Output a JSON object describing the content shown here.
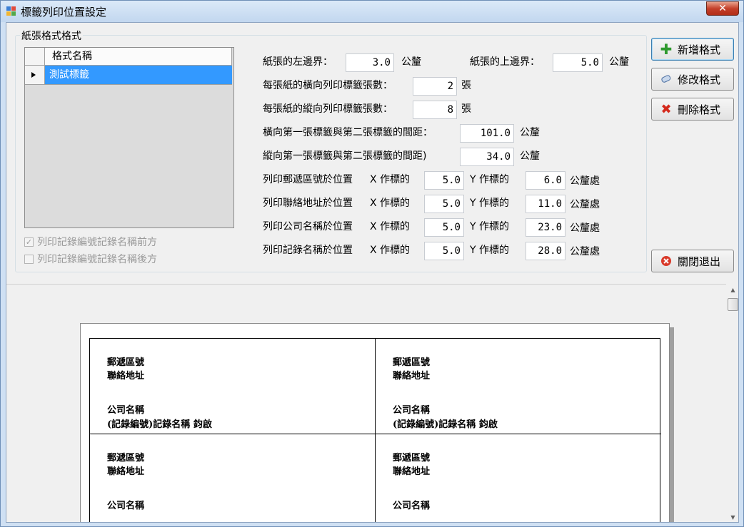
{
  "window": {
    "title": "標籤列印位置設定",
    "close_label": "✕"
  },
  "group": {
    "title": "紙張格式格式"
  },
  "grid": {
    "column_header": "格式名稱",
    "rows": [
      "測試標籤"
    ]
  },
  "checkboxes": [
    {
      "label": "列印記錄編號記錄名稱前方",
      "checked": true
    },
    {
      "label": "列印記錄編號記錄名稱後方",
      "checked": false
    }
  ],
  "settings": {
    "left_margin_label": "紙張的左邊界：",
    "left_margin": "3.0",
    "top_margin_label": "紙張的上邊界：",
    "top_margin": "5.0",
    "unit_mm": "公釐",
    "horizontal_count_label": "每張紙的橫向列印標籤張數：",
    "horizontal_count": "2",
    "vertical_count_label": "每張紙的縱向列印標籤張數：",
    "vertical_count": "8",
    "unit_sheet": "張",
    "h_gap_label": "橫向第一張標籤與第二張標籤的間距：",
    "h_gap": "101.0",
    "v_gap_label": "縱向第一張標籤與第二張標籤的間距)",
    "v_gap": "34.0"
  },
  "positions": {
    "x_label": "X 作標的",
    "y_label": "Y 作標的",
    "unit_label": "公釐處",
    "rows": [
      {
        "label": "列印郵遞區號於位置",
        "x": "5.0",
        "y": "6.0"
      },
      {
        "label": "列印聯絡地址於位置",
        "x": "5.0",
        "y": "11.0"
      },
      {
        "label": "列印公司名稱於位置",
        "x": "5.0",
        "y": "23.0"
      },
      {
        "label": "列印記錄名稱於位置",
        "x": "5.0",
        "y": "28.0"
      }
    ]
  },
  "buttons": {
    "add": "新增格式",
    "edit": "修改格式",
    "delete": "刪除格式",
    "exit": "關閉退出"
  },
  "preview": {
    "labels": [
      {
        "postal": "郵遞區號",
        "address": "聯絡地址",
        "company": "公司名稱",
        "record": "(記錄編號)記錄名稱 鈞啟"
      },
      {
        "postal": "郵遞區號",
        "address": "聯絡地址",
        "company": "公司名稱",
        "record": "(記錄編號)記錄名稱 鈞啟"
      },
      {
        "postal": "郵遞區號",
        "address": "聯絡地址",
        "company": "公司名稱"
      },
      {
        "postal": "郵遞區號",
        "address": "聯絡地址",
        "company": "公司名稱"
      }
    ]
  }
}
